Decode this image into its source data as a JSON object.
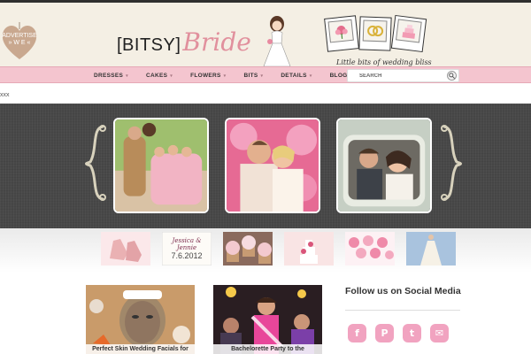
{
  "header": {
    "advertise_label": "ADVERTISE",
    "advertise_sub": "» W E «",
    "logo_bitsy": "[BITSY]",
    "logo_bride": "Bride",
    "tagline": "Little bits of wedding bliss"
  },
  "nav": {
    "items": [
      {
        "label": "DRESSES"
      },
      {
        "label": "CAKES"
      },
      {
        "label": "FLOWERS"
      },
      {
        "label": "BITS"
      },
      {
        "label": "DETAILS"
      },
      {
        "label": "BLOG"
      }
    ],
    "arrow": "▾"
  },
  "search": {
    "value": "SEARCH"
  },
  "misc": {
    "xxx": "xxx"
  },
  "thumbs": {
    "invite_names": "Jessica & Jennie",
    "invite_date": "7.6.2012"
  },
  "cards": [
    {
      "caption": "Perfect Skin Wedding Facials for"
    },
    {
      "caption": "Bachelorette Party to the"
    }
  ],
  "social": {
    "title": "Follow us on Social Media",
    "icons": [
      {
        "icon": "facebook-icon",
        "glyph": "f"
      },
      {
        "icon": "pinterest-icon",
        "glyph": "P"
      },
      {
        "icon": "twitter-icon",
        "glyph": "t"
      },
      {
        "icon": "email-icon",
        "glyph": "✉"
      }
    ]
  },
  "colors": {
    "nav_pink": "#f4c5cf",
    "brand_pink": "#e1909d",
    "social_pink": "#f1a3c0",
    "slider_dark": "#484848"
  }
}
